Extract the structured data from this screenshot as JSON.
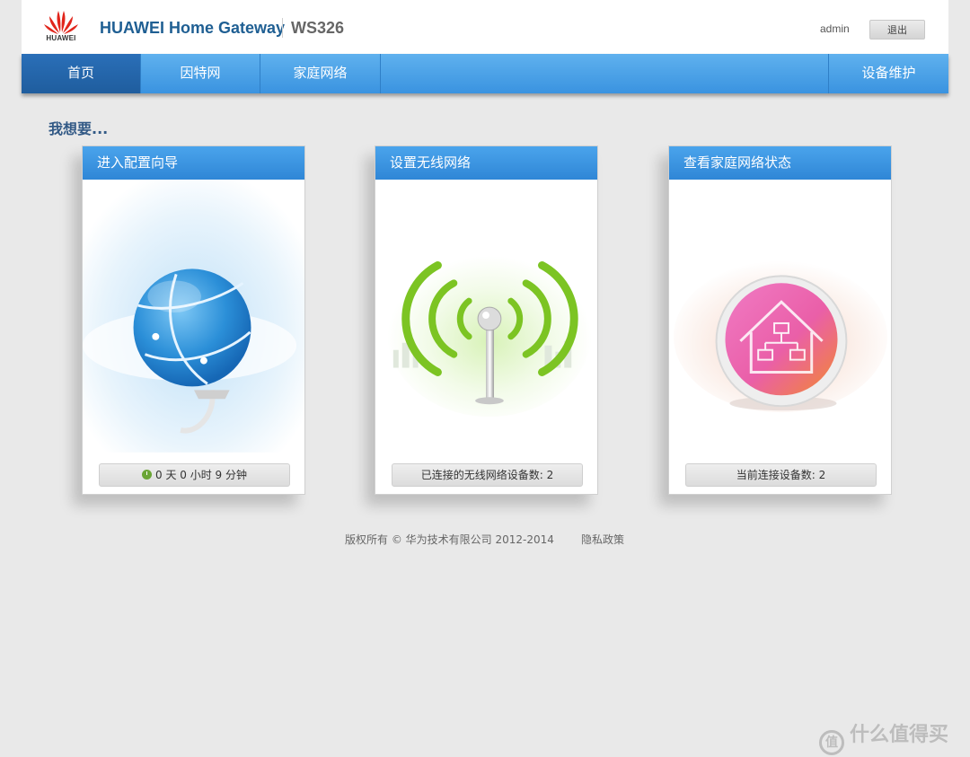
{
  "header": {
    "logo_text": "HUAWEI",
    "brand": "HUAWEI Home Gateway",
    "model": "WS326",
    "user": "admin",
    "logout_label": "退出"
  },
  "nav": {
    "items": [
      {
        "label": "首页",
        "active": true
      },
      {
        "label": "因特网",
        "active": false
      },
      {
        "label": "家庭网络",
        "active": false
      },
      {
        "label": "设备维护",
        "active": false
      }
    ]
  },
  "main": {
    "section_title": "我想要...",
    "cards": [
      {
        "title": "进入配置向导",
        "status": "0 天 0 小时 9 分钟",
        "icon": "globe-icon"
      },
      {
        "title": "设置无线网络",
        "status": "已连接的无线网络设备数:  2",
        "icon": "wifi-antenna-icon"
      },
      {
        "title": "查看家庭网络状态",
        "status": "当前连接设备数:  2",
        "icon": "home-network-icon"
      }
    ]
  },
  "footer": {
    "copyright": "版权所有 © 华为技术有限公司 2012-2014",
    "privacy": "隐私政策"
  },
  "watermark": {
    "icon_text": "值",
    "text": "什么值得买"
  },
  "colors": {
    "nav_blue": "#3a93e0",
    "active_nav": "#1f5d9e",
    "brand_blue": "#1f5f93",
    "brand_red": "#e1251b"
  }
}
